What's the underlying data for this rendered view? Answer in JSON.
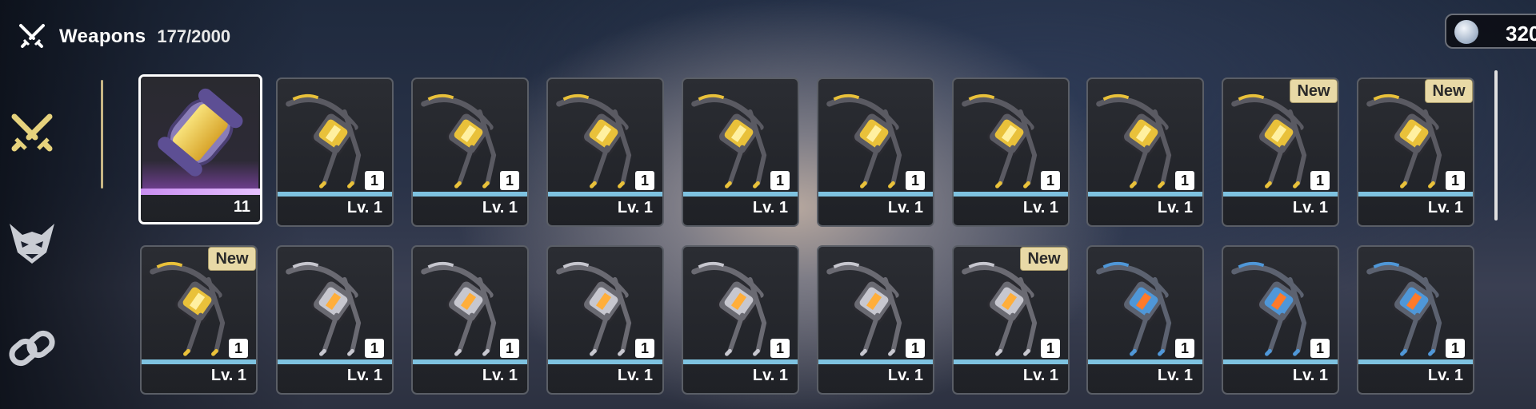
{
  "header": {
    "title": "Weapons",
    "count": "177/2000",
    "icon": "crossed-swords-icon"
  },
  "currency": {
    "value": "320",
    "icon": "silver-coin-icon"
  },
  "nav": [
    {
      "name": "weapons-tab",
      "icon": "crossed-swords-icon",
      "active": true
    },
    {
      "name": "matrices-tab",
      "icon": "demon-mask-icon",
      "active": false
    },
    {
      "name": "relics-tab",
      "icon": "chain-link-icon",
      "active": false
    }
  ],
  "colors": {
    "accent_gold": "#e0cc7a",
    "level_bar": "#7ec2e0",
    "selected_bar": "#d9a6ff",
    "badge_bg": "#e8d9a6"
  },
  "rows": [
    [
      {
        "kind": "capsule",
        "qty": "11",
        "selected": true
      },
      {
        "kind": "gold-bow",
        "qty": "1",
        "level": "Lv. 1"
      },
      {
        "kind": "gold-bow",
        "qty": "1",
        "level": "Lv. 1"
      },
      {
        "kind": "gold-bow",
        "qty": "1",
        "level": "Lv. 1"
      },
      {
        "kind": "gold-bow",
        "qty": "1",
        "level": "Lv. 1"
      },
      {
        "kind": "gold-bow",
        "qty": "1",
        "level": "Lv. 1"
      },
      {
        "kind": "gold-bow",
        "qty": "1",
        "level": "Lv. 1"
      },
      {
        "kind": "gold-bow",
        "qty": "1",
        "level": "Lv. 1"
      },
      {
        "kind": "gold-bow",
        "qty": "1",
        "level": "Lv. 1",
        "badge": "New"
      },
      {
        "kind": "gold-bow",
        "qty": "1",
        "level": "Lv. 1",
        "badge": "New"
      }
    ],
    [
      {
        "kind": "gold-bow",
        "qty": "1",
        "level": "Lv. 1",
        "badge": "New"
      },
      {
        "kind": "silver-bow",
        "qty": "1",
        "level": "Lv. 1"
      },
      {
        "kind": "silver-bow",
        "qty": "1",
        "level": "Lv. 1"
      },
      {
        "kind": "silver-bow",
        "qty": "1",
        "level": "Lv. 1"
      },
      {
        "kind": "silver-bow",
        "qty": "1",
        "level": "Lv. 1"
      },
      {
        "kind": "silver-bow",
        "qty": "1",
        "level": "Lv. 1"
      },
      {
        "kind": "silver-bow",
        "qty": "1",
        "level": "Lv. 1",
        "badge": "New"
      },
      {
        "kind": "blue-cannon",
        "qty": "1",
        "level": "Lv. 1"
      },
      {
        "kind": "blue-cannon",
        "qty": "1",
        "level": "Lv. 1"
      },
      {
        "kind": "blue-cannon",
        "qty": "1",
        "level": "Lv. 1"
      }
    ]
  ]
}
